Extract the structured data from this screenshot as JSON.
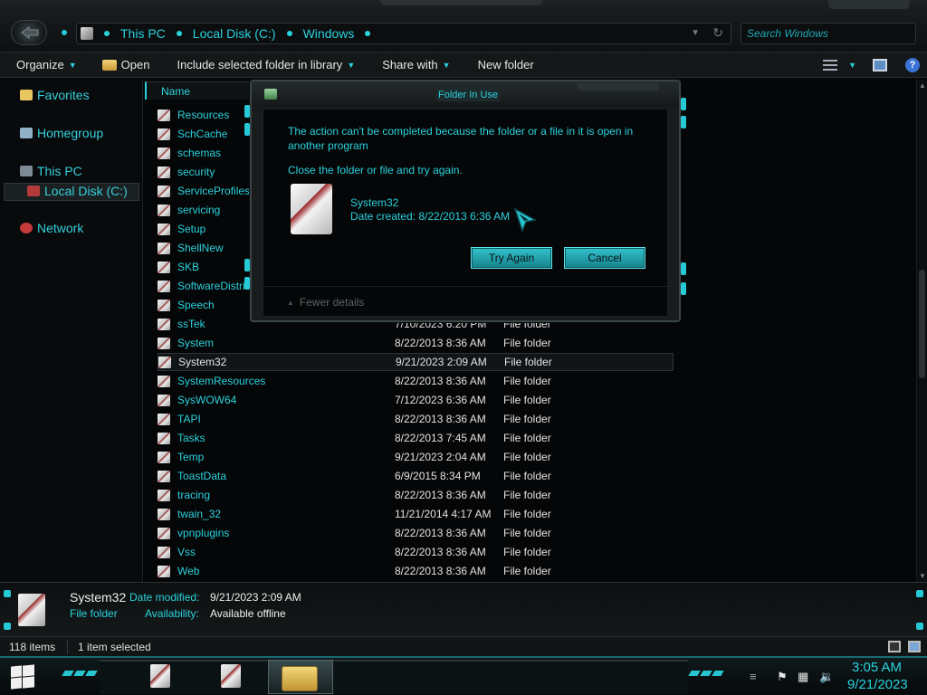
{
  "address": {
    "crumbs": [
      "This PC",
      "Local Disk (C:)",
      "Windows"
    ],
    "search_placeholder": "Search Windows"
  },
  "toolbar": {
    "organize": "Organize",
    "open": "Open",
    "include": "Include selected folder in library",
    "share": "Share with",
    "new_folder": "New folder"
  },
  "nav": {
    "favorites": "Favorites",
    "homegroup": "Homegroup",
    "this_pc": "This PC",
    "local_disk": "Local Disk (C:)",
    "network": "Network"
  },
  "list": {
    "column_name": "Name",
    "rows": [
      {
        "name": "Resources",
        "date": "",
        "type": ""
      },
      {
        "name": "SchCache",
        "date": "",
        "type": ""
      },
      {
        "name": "schemas",
        "date": "",
        "type": ""
      },
      {
        "name": "security",
        "date": "",
        "type": ""
      },
      {
        "name": "ServiceProfiles",
        "date": "",
        "type": ""
      },
      {
        "name": "servicing",
        "date": "",
        "type": ""
      },
      {
        "name": "Setup",
        "date": "",
        "type": ""
      },
      {
        "name": "ShellNew",
        "date": "",
        "type": ""
      },
      {
        "name": "SKB",
        "date": "",
        "type": ""
      },
      {
        "name": "SoftwareDistri",
        "date": "",
        "type": ""
      },
      {
        "name": "Speech",
        "date": "",
        "type": ""
      },
      {
        "name": "ssTek",
        "date": "7/10/2023 6:20 PM",
        "type": "File folder"
      },
      {
        "name": "System",
        "date": "8/22/2013 8:36 AM",
        "type": "File folder"
      },
      {
        "name": "System32",
        "date": "9/21/2023 2:09 AM",
        "type": "File folder"
      },
      {
        "name": "SystemResources",
        "date": "8/22/2013 8:36 AM",
        "type": "File folder"
      },
      {
        "name": "SysWOW64",
        "date": "7/12/2023 6:36 AM",
        "type": "File folder"
      },
      {
        "name": "TAPI",
        "date": "8/22/2013 8:36 AM",
        "type": "File folder"
      },
      {
        "name": "Tasks",
        "date": "8/22/2013 7:45 AM",
        "type": "File folder"
      },
      {
        "name": "Temp",
        "date": "9/21/2023 2:04 AM",
        "type": "File folder"
      },
      {
        "name": "ToastData",
        "date": "6/9/2015 8:34 PM",
        "type": "File folder"
      },
      {
        "name": "tracing",
        "date": "8/22/2013 8:36 AM",
        "type": "File folder"
      },
      {
        "name": "twain_32",
        "date": "11/21/2014 4:17 AM",
        "type": "File folder"
      },
      {
        "name": "vpnplugins",
        "date": "8/22/2013 8:36 AM",
        "type": "File folder"
      },
      {
        "name": "Vss",
        "date": "8/22/2013 8:36 AM",
        "type": "File folder"
      },
      {
        "name": "Web",
        "date": "8/22/2013 8:36 AM",
        "type": "File folder"
      }
    ],
    "selected_index": 13
  },
  "details": {
    "name": "System32",
    "type": "File folder",
    "modified_label": "Date modified:",
    "modified_value": "9/21/2023 2:09 AM",
    "availability_label": "Availability:",
    "availability_value": "Available offline"
  },
  "status": {
    "items": "118 items",
    "selected": "1 item selected"
  },
  "dialog": {
    "title": "Folder In Use",
    "message": "The action can't be completed because the folder or a file in it is open in another program",
    "instruction": "Close the folder or file and try again.",
    "file_name": "System32",
    "file_date": "Date created: 8/22/2013 6:36 AM",
    "try_again": "Try Again",
    "cancel": "Cancel",
    "fewer_details": "Fewer details"
  },
  "clock": {
    "time": "3:05 AM",
    "date": "9/21/2023"
  },
  "colors": {
    "accent": "#2ad2dd",
    "background": "#050607",
    "button": "#26b3be"
  }
}
